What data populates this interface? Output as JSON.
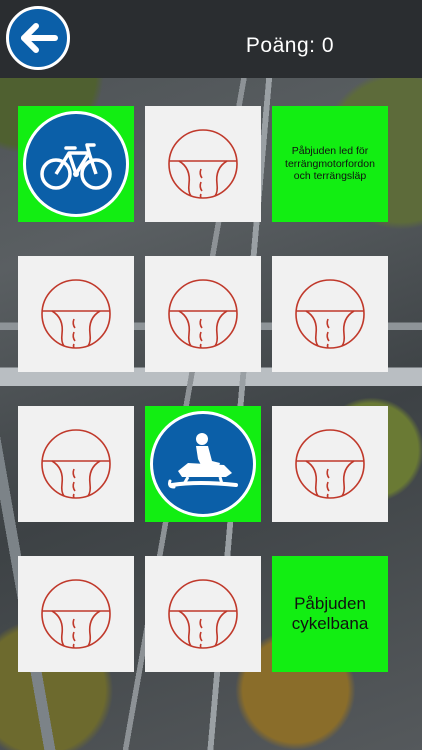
{
  "header": {
    "back_icon": "arrow-left-icon",
    "score_label": "Poäng:",
    "score_value": "0"
  },
  "colors": {
    "matched_card": "#12ee12",
    "hidden_card": "#f1f1f1",
    "sign_blue": "#0b5fa8",
    "card_back_stroke": "#c0392b"
  },
  "cards": [
    {
      "state": "revealed",
      "kind": "sign",
      "icon": "bicycle-sign-icon"
    },
    {
      "state": "hidden",
      "icon": "road-logo-icon"
    },
    {
      "state": "revealed",
      "kind": "text",
      "text": "Påbjuden led för terrängmotorfordon och terrängsläp"
    },
    {
      "state": "hidden",
      "icon": "road-logo-icon"
    },
    {
      "state": "hidden",
      "icon": "road-logo-icon"
    },
    {
      "state": "hidden",
      "icon": "road-logo-icon"
    },
    {
      "state": "hidden",
      "icon": "road-logo-icon"
    },
    {
      "state": "revealed",
      "kind": "sign",
      "icon": "snowmobile-sign-icon"
    },
    {
      "state": "hidden",
      "icon": "road-logo-icon"
    },
    {
      "state": "hidden",
      "icon": "road-logo-icon"
    },
    {
      "state": "hidden",
      "icon": "road-logo-icon"
    },
    {
      "state": "revealed",
      "kind": "text",
      "text": "Påbjuden cykelbana"
    }
  ]
}
